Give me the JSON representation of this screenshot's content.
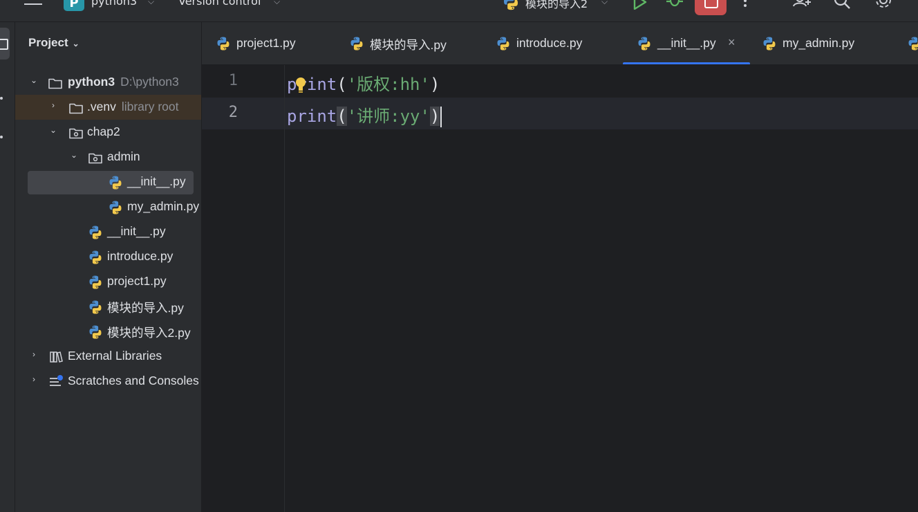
{
  "topbar": {
    "project_badge": "P",
    "project_name": "python3",
    "vcs_label": "Version control",
    "run_config": "模块的导入2"
  },
  "project_panel": {
    "title": "Project",
    "tree": [
      {
        "label": "python3",
        "hint": "D:\\python3"
      },
      {
        "label": ".venv",
        "hint": "library root"
      },
      {
        "label": "chap2"
      },
      {
        "label": "admin"
      },
      {
        "label": "__init__.py"
      },
      {
        "label": "my_admin.py"
      },
      {
        "label": "__init__.py"
      },
      {
        "label": "introduce.py"
      },
      {
        "label": "project1.py"
      },
      {
        "label": "模块的导入.py"
      },
      {
        "label": "模块的导入2.py"
      },
      {
        "label": "External Libraries"
      },
      {
        "label": "Scratches and Consoles"
      }
    ]
  },
  "tabs": [
    {
      "label": "project1.py"
    },
    {
      "label": "模块的导入.py"
    },
    {
      "label": "introduce.py"
    },
    {
      "label": "__init__.py",
      "close": "×"
    },
    {
      "label": "my_admin.py"
    }
  ],
  "editor": {
    "lines": [
      {
        "num": "1",
        "fn": "print",
        "open": "(",
        "str": "'版权:hh'",
        "close": ")"
      },
      {
        "num": "2",
        "fn": "print",
        "open": "(",
        "str": "'讲师:yy'",
        "close": ")"
      }
    ]
  },
  "colors": {
    "background": "#1e1f22",
    "panel": "#2b2d30",
    "accent": "#3574f0",
    "keyword": "#a9a6e4",
    "string": "#6aab73",
    "stop_button": "#c94f4f",
    "run_green": "#5fb865"
  },
  "icons": [
    "menu-icon",
    "chevron-down-icon",
    "python-icon",
    "run-icon",
    "debug-icon",
    "stop-icon",
    "more-icon",
    "add-user-icon",
    "search-icon",
    "settings-icon",
    "folder-icon",
    "library-icon",
    "scratches-icon",
    "close-icon",
    "lightbulb-icon"
  ]
}
